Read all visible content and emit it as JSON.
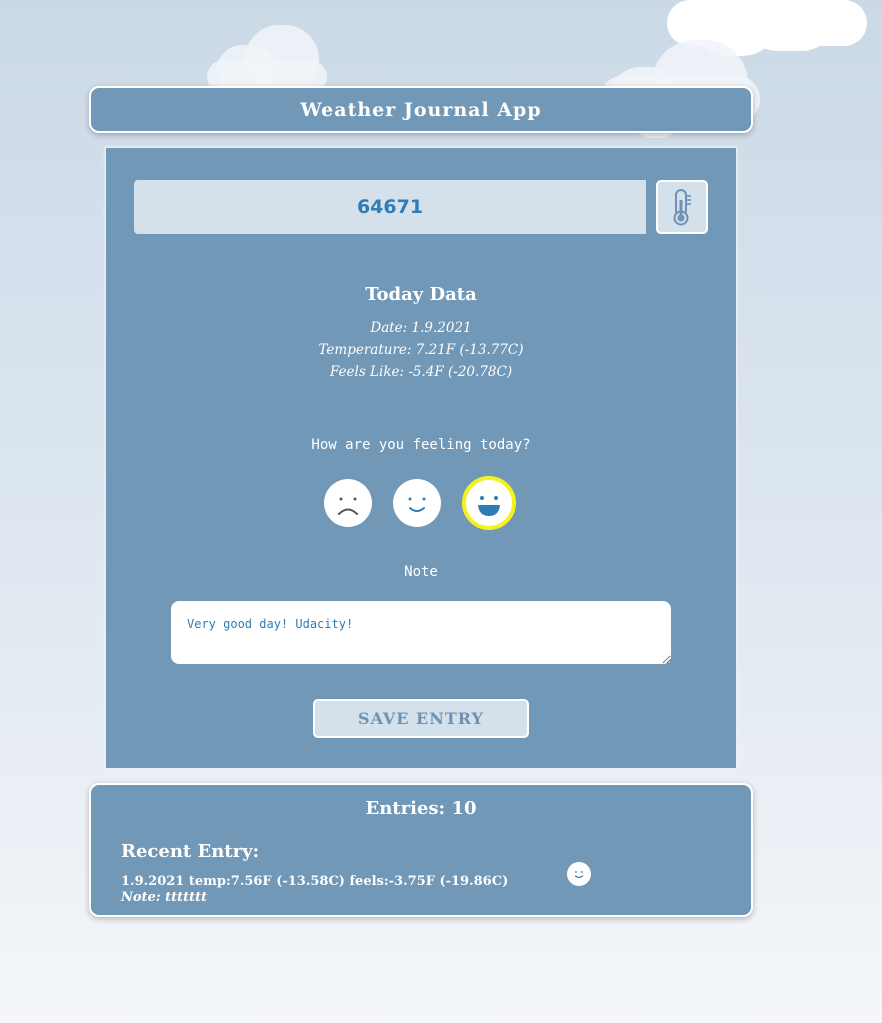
{
  "app": {
    "title": "Weather Journal App"
  },
  "zip": {
    "value": "64671"
  },
  "temp_button": {
    "icon": "thermometer-icon"
  },
  "today": {
    "heading": "Today Data",
    "date": "Date: 1.9.2021",
    "temperature": "Temperature: 7.21F (-13.77C)",
    "feels_like": "Feels Like: -5.4F (-20.78C)"
  },
  "feeling": {
    "label": "How are you feeling today?",
    "options": [
      {
        "icon": "sad-face-icon",
        "selected": false
      },
      {
        "icon": "smile-face-icon",
        "selected": false
      },
      {
        "icon": "happy-face-icon",
        "selected": true
      }
    ]
  },
  "note": {
    "label": "Note",
    "value": "Very good day! Udacity!"
  },
  "save": {
    "label": "SAVE ENTRY"
  },
  "entries": {
    "count_label": "Entries: 10",
    "recent_title": "Recent Entry:",
    "recent_data": "1.9.2021 temp:7.56F (-13.58C) feels:-3.75F (-19.86C)",
    "recent_note": "Note: ttttttt",
    "recent_mood_icon": "smile-face-icon"
  },
  "colors": {
    "panel": "#7198b7",
    "accent": "#2f7db4",
    "selected_ring": "#f4f21c",
    "input_bg": "#d4e0ea"
  }
}
